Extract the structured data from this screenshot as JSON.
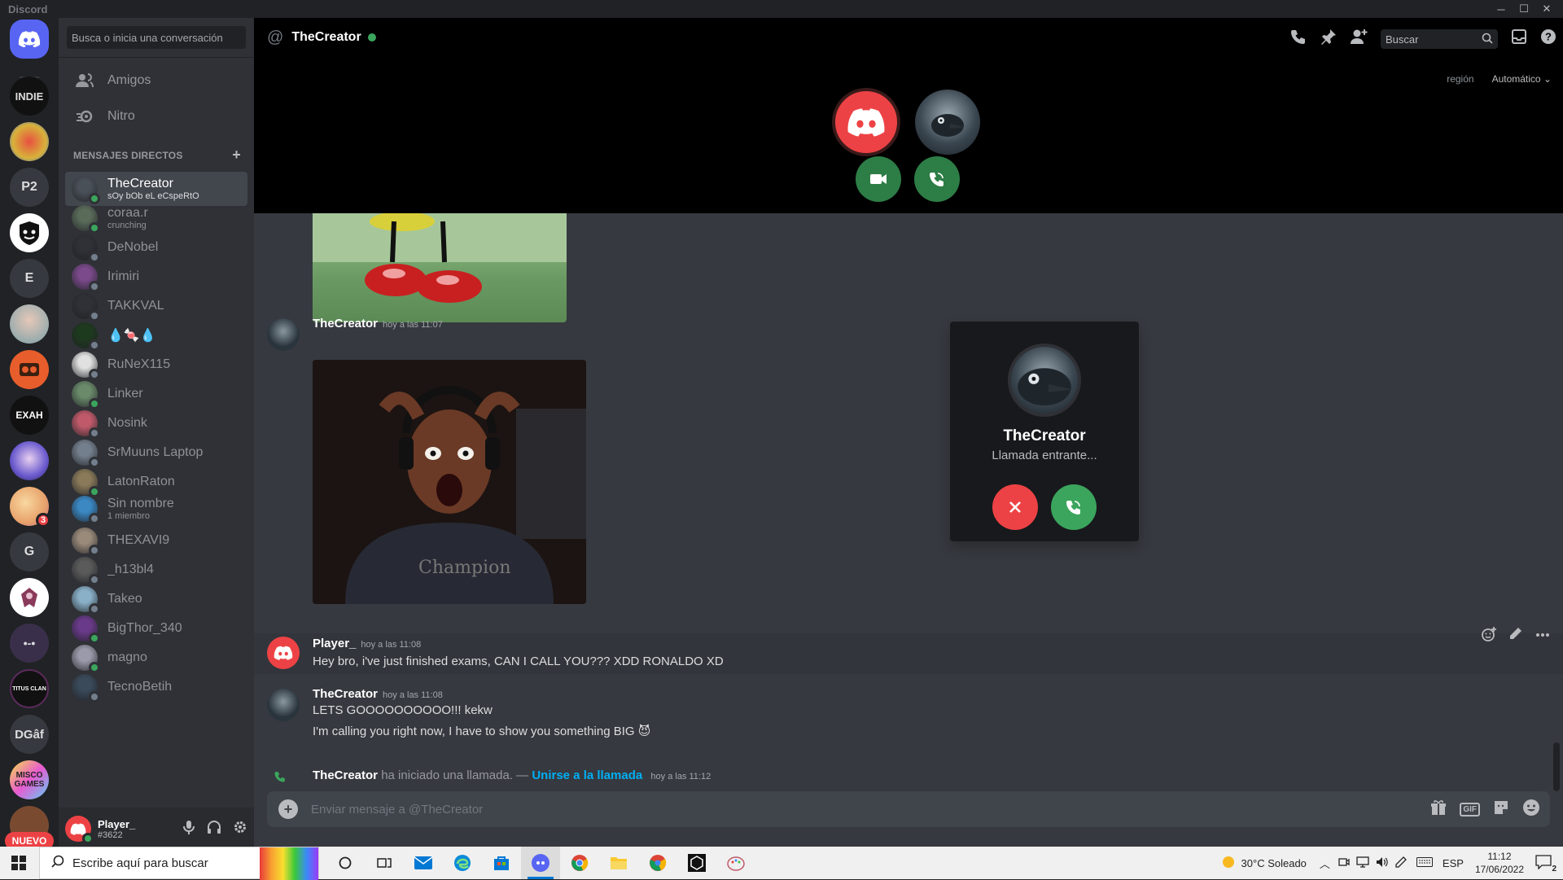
{
  "window": {
    "title": "Discord",
    "controls": [
      "─",
      "☐",
      "✕"
    ]
  },
  "rail": {
    "servers": [
      {
        "label": "INDIE",
        "color": "#111111"
      },
      {
        "label": "",
        "color": "#d8b23a"
      },
      {
        "label": "P2",
        "color": "#36393f"
      },
      {
        "label": "",
        "color": "#ffffff"
      },
      {
        "label": "E",
        "color": "#36393f"
      },
      {
        "label": "",
        "color": "#7aa0a8"
      },
      {
        "label": "",
        "color": "#e85d2c"
      },
      {
        "label": "EXAH",
        "color": "#111111"
      },
      {
        "label": "",
        "color": "#6a5acd"
      },
      {
        "label": "",
        "color": "#e8a26b",
        "badge": "3"
      },
      {
        "label": "G",
        "color": "#36393f"
      },
      {
        "label": "",
        "color": "#ffffff"
      },
      {
        "label": "•-•",
        "color": "#3a2f4a"
      },
      {
        "label": "TITUS CLAN",
        "color": "#5a2a5a"
      },
      {
        "label": "DGâf",
        "color": "#36393f"
      },
      {
        "label": "MISCO GAMES",
        "color": "#d47ac0"
      }
    ],
    "new_label": "NUEVO"
  },
  "sidebar": {
    "search_placeholder": "Busca o inicia una conversación",
    "nav": [
      {
        "label": "Amigos",
        "icon": "friends-icon"
      },
      {
        "label": "Nitro",
        "icon": "nitro-icon"
      }
    ],
    "dm_header": "MENSAJES DIRECTOS",
    "dms": [
      {
        "name": "TheCreator",
        "sub": "sOy bOb eL eCspeRtO",
        "color": "#4a5058",
        "online": true,
        "active": true
      },
      {
        "name": "coraa.r",
        "sub": "crunching",
        "color": "#5a6b5a",
        "online": true
      },
      {
        "name": "DeNobel",
        "sub": "",
        "color": "#2f3136",
        "online": false
      },
      {
        "name": "Irimiri",
        "sub": "",
        "color": "#7a4a8a",
        "online": false
      },
      {
        "name": "TAKKVAL",
        "sub": "",
        "color": "#2f3136",
        "online": false
      },
      {
        "name": "💧🍬💧",
        "sub": "",
        "color": "#1e3a1e",
        "online": false
      },
      {
        "name": "RuNeX115",
        "sub": "",
        "color": "#e0e0e0",
        "online": false
      },
      {
        "name": "Linker",
        "sub": "",
        "color": "#6a8a6a",
        "online": true
      },
      {
        "name": "Nosink",
        "sub": "",
        "color": "#c05a6a",
        "online": false
      },
      {
        "name": "SrMuuns Laptop",
        "sub": "",
        "color": "#747f8d",
        "online": false
      },
      {
        "name": "LatonRaton",
        "sub": "",
        "color": "#8a7a5a",
        "online": true
      },
      {
        "name": "Sin nombre",
        "sub": "1 miembro",
        "color": "#3b88c3",
        "online": false
      },
      {
        "name": "THEXAVI9",
        "sub": "",
        "color": "#9a8a7a",
        "online": false
      },
      {
        "name": "_h13bl4",
        "sub": "",
        "color": "#5a5a5a",
        "online": false
      },
      {
        "name": "Takeo",
        "sub": "",
        "color": "#8ab0c8",
        "online": false
      },
      {
        "name": "BigThor_340",
        "sub": "",
        "color": "#6a3a8a",
        "online": true
      },
      {
        "name": "magno",
        "sub": "",
        "color": "#9a9aaa",
        "online": true
      },
      {
        "name": "TecnoBetih",
        "sub": "",
        "color": "#3a4a5a",
        "online": false
      }
    ]
  },
  "user": {
    "name": "Player_",
    "tag": "#3622"
  },
  "header": {
    "channel": "TheCreator",
    "search_placeholder": "Buscar",
    "region_label": "región",
    "region_value": "Automático"
  },
  "messages": [
    {
      "author": "TheCreator",
      "time": "hoy a las 11:07"
    },
    {
      "author": "Player_",
      "time": "hoy a las 11:08",
      "text": "Hey bro, i've just finished exams, CAN I CALL YOU??? XDD RONALDO XD"
    },
    {
      "author": "TheCreator",
      "time": "hoy a las 11:08",
      "lines": [
        "LETS GOOOOOOOOOO!!! kekw",
        "I'm calling you right now, I have to show you something BIG 😈"
      ]
    }
  ],
  "system": {
    "author": "TheCreator",
    "action": "ha iniciado una llamada. — ",
    "join": "Unirse a la llamada",
    "time": "hoy a las 11:12"
  },
  "composer": {
    "placeholder": "Enviar mensaje a @TheCreator",
    "gif": "GIF"
  },
  "incoming": {
    "name": "TheCreator",
    "status": "Llamada entrante..."
  },
  "taskbar": {
    "search": "Escribe aquí para buscar",
    "weather": "30°C  Soleado",
    "lang": "ESP",
    "time": "11:12",
    "date": "17/06/2022",
    "notif": "2"
  }
}
